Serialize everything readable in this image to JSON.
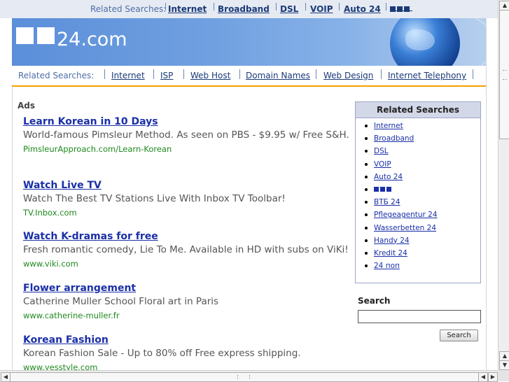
{
  "top_bar": {
    "label": "Related Searches:",
    "links": [
      "Internet",
      "Broadband",
      "DSL",
      "VOIP",
      "Auto 24"
    ]
  },
  "header": {
    "logo_text": "24.com"
  },
  "nav": {
    "label": "Related Searches:",
    "links": [
      "Internet",
      "ISP",
      "Web Host",
      "Domain Names",
      "Web Design",
      "Internet Telephony"
    ]
  },
  "ads": {
    "label": "Ads",
    "items": [
      {
        "title": "Learn Korean in 10 Days",
        "desc": "World-famous Pimsleur Method. As seen on PBS - $9.95 w/ Free S&H.",
        "url": "PimsleurApproach.com/Learn-Korean"
      },
      {
        "title": "Watch Live TV",
        "desc": "Watch The Best TV Stations Live With Inbox TV Toolbar!",
        "url": "TV.Inbox.com"
      },
      {
        "title": "Watch K-dramas for free",
        "desc": "Fresh romantic comedy, Lie To Me. Available in HD with subs on ViKi!",
        "url": "www.viki.com"
      },
      {
        "title": "Flower arrangement",
        "desc": "Catherine Muller School Floral art in Paris",
        "url": "www.catherine-muller.fr"
      },
      {
        "title": "Korean Fashion",
        "desc": "Korean Fashion Sale - Up to 80% off Free express shipping.",
        "url": "www.yesstyle.com"
      }
    ]
  },
  "related_box": {
    "title": "Related Searches",
    "items": [
      "Internet",
      "Broadband",
      "DSL",
      "VOIP",
      "Auto 24",
      "",
      "ВТБ 24",
      "Pflegeagentur 24",
      "Wasserbetten 24",
      "Handy 24",
      "Kredit 24",
      "24 поп"
    ]
  },
  "search": {
    "label": "Search",
    "value": "",
    "button": "Search"
  },
  "colors": {
    "link": "#1a2fa8",
    "url_green": "#1e8a1e",
    "header_blue": "#5c8fd8",
    "nav_underline": "#f0a200"
  }
}
